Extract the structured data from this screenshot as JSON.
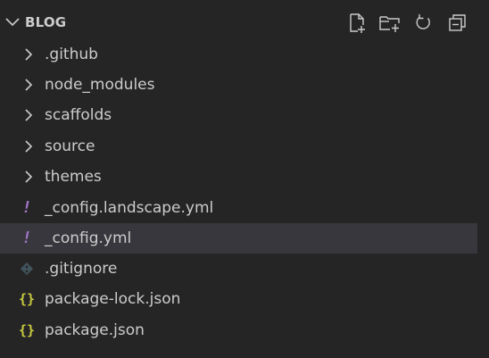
{
  "explorer": {
    "title": "BLOG",
    "actions": [
      {
        "name": "new-file-icon"
      },
      {
        "name": "new-folder-icon"
      },
      {
        "name": "refresh-icon"
      },
      {
        "name": "collapse-all-icon"
      }
    ],
    "items": [
      {
        "label": ".github",
        "type": "folder",
        "expanded": false
      },
      {
        "label": "node_modules",
        "type": "folder",
        "expanded": false
      },
      {
        "label": "scaffolds",
        "type": "folder",
        "expanded": false
      },
      {
        "label": "source",
        "type": "folder",
        "expanded": false
      },
      {
        "label": "themes",
        "type": "folder",
        "expanded": false
      },
      {
        "label": "_config.landscape.yml",
        "type": "yaml",
        "icon": "yaml-file-icon",
        "icon_glyph": "!"
      },
      {
        "label": "_config.yml",
        "type": "yaml",
        "icon": "yaml-file-icon",
        "icon_glyph": "!",
        "selected": true
      },
      {
        "label": ".gitignore",
        "type": "git",
        "icon": "git-file-icon"
      },
      {
        "label": "package-lock.json",
        "type": "json",
        "icon": "json-file-icon",
        "icon_glyph": "{}"
      },
      {
        "label": "package.json",
        "type": "json",
        "icon": "json-file-icon",
        "icon_glyph": "{}"
      }
    ]
  },
  "colors": {
    "background": "#252526",
    "selected_row": "#37373d",
    "text": "#cccccc",
    "yaml_icon": "#a074c4",
    "json_icon": "#cbcb41",
    "git_icon": "#41535b"
  }
}
